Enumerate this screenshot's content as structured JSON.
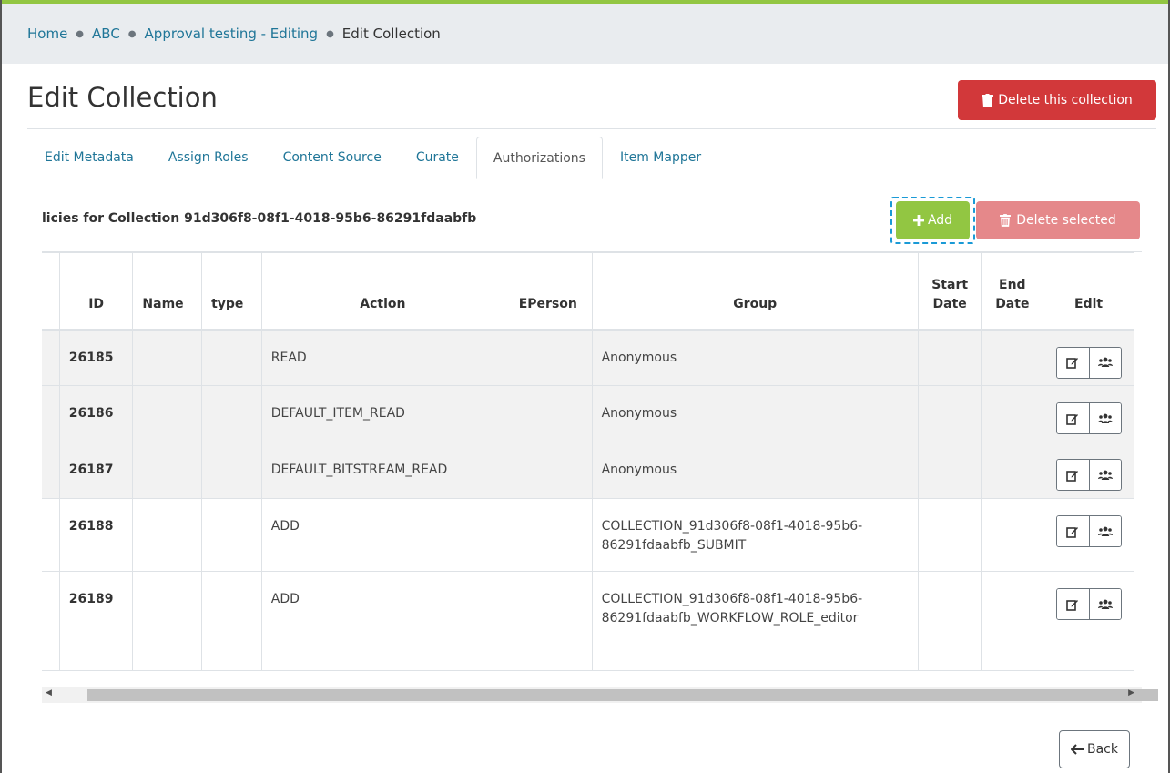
{
  "breadcrumb": [
    {
      "label": "Home",
      "link": true
    },
    {
      "label": "ABC",
      "link": true
    },
    {
      "label": "Approval testing - Editing",
      "link": true
    },
    {
      "label": "Edit Collection",
      "link": false
    }
  ],
  "page": {
    "title": "Edit Collection",
    "delete_collection_label": "Delete this collection"
  },
  "tabs": [
    {
      "label": "Edit Metadata",
      "active": false
    },
    {
      "label": "Assign Roles",
      "active": false
    },
    {
      "label": "Content Source",
      "active": false
    },
    {
      "label": "Curate",
      "active": false
    },
    {
      "label": "Authorizations",
      "active": true
    },
    {
      "label": "Item Mapper",
      "active": false
    }
  ],
  "policies": {
    "heading": "licies for Collection 91d306f8-08f1-4018-95b6-86291fdaabfb",
    "add_label": "Add",
    "delete_selected_label": "Delete selected"
  },
  "table": {
    "headers": {
      "id": "ID",
      "name": "Name",
      "type": "type",
      "action": "Action",
      "eperson": "EPerson",
      "group": "Group",
      "start_date_1": "Start",
      "start_date_2": "Date",
      "end_date_1": "End",
      "end_date_2": "Date",
      "edit": "Edit"
    },
    "rows": [
      {
        "id": "26185",
        "name": "",
        "type": "",
        "action": "READ",
        "eperson": "",
        "group": "Anonymous",
        "start": "",
        "end": ""
      },
      {
        "id": "26186",
        "name": "",
        "type": "",
        "action": "DEFAULT_ITEM_READ",
        "eperson": "",
        "group": "Anonymous",
        "start": "",
        "end": ""
      },
      {
        "id": "26187",
        "name": "",
        "type": "",
        "action": "DEFAULT_BITSTREAM_READ",
        "eperson": "",
        "group": "Anonymous",
        "start": "",
        "end": ""
      },
      {
        "id": "26188",
        "name": "",
        "type": "",
        "action": "ADD",
        "eperson": "",
        "group": "COLLECTION_91d306f8-08f1-4018-95b6-86291fdaabfb_SUBMIT",
        "start": "",
        "end": ""
      },
      {
        "id": "26189",
        "name": "",
        "type": "",
        "action": "ADD",
        "eperson": "",
        "group": "COLLECTION_91d306f8-08f1-4018-95b6-86291fdaabfb_WORKFLOW_ROLE_editor",
        "start": "",
        "end": ""
      }
    ]
  },
  "back_label": "Back",
  "colors": {
    "accent_green": "#92c642",
    "danger": "#d2383a",
    "danger_disabled": "#e5888a",
    "link": "#207698",
    "focus_outline": "#1a9ad6"
  },
  "icons": {
    "delete_collection": "trash-icon",
    "add": "plus-icon",
    "delete_selected": "trash-icon",
    "row_edit": "edit-icon",
    "row_group": "users-icon",
    "back": "arrow-left-icon"
  }
}
